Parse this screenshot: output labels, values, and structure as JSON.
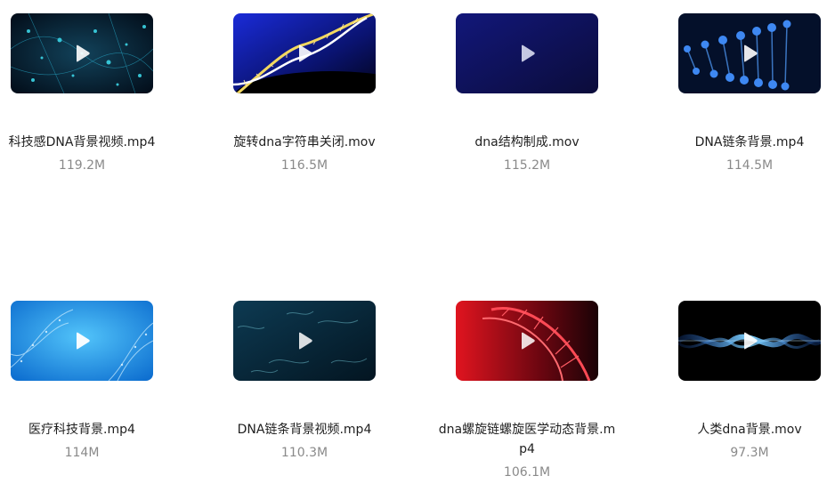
{
  "files": [
    {
      "name": "科技感DNA背景视频.mp4",
      "size": "119.2M",
      "thumb_theme": "cyan-particles"
    },
    {
      "name": "旋转dna字符串关闭.mov",
      "size": "116.5M",
      "thumb_theme": "helix-gold-blue"
    },
    {
      "name": "dna结构制成.mov",
      "size": "115.2M",
      "thumb_theme": "dark-navy"
    },
    {
      "name": "DNA链条背景.mp4",
      "size": "114.5M",
      "thumb_theme": "blue-spheres"
    },
    {
      "name": "医疗科技背景.mp4",
      "size": "114M",
      "thumb_theme": "light-blue-helix"
    },
    {
      "name": "DNA链条背景视频.mp4",
      "size": "110.3M",
      "thumb_theme": "teal-strands"
    },
    {
      "name": "dna螺旋链螺旋医学动态背景.mp4",
      "size": "106.1M",
      "thumb_theme": "red-helix"
    },
    {
      "name": "人类dna背景.mov",
      "size": "97.3M",
      "thumb_theme": "glowing-wave"
    }
  ],
  "icons": {
    "play": "play-icon"
  },
  "colors": {
    "name_text": "#1f1f1f",
    "size_text": "#8a8a8a",
    "play_icon": "#ffffff"
  }
}
